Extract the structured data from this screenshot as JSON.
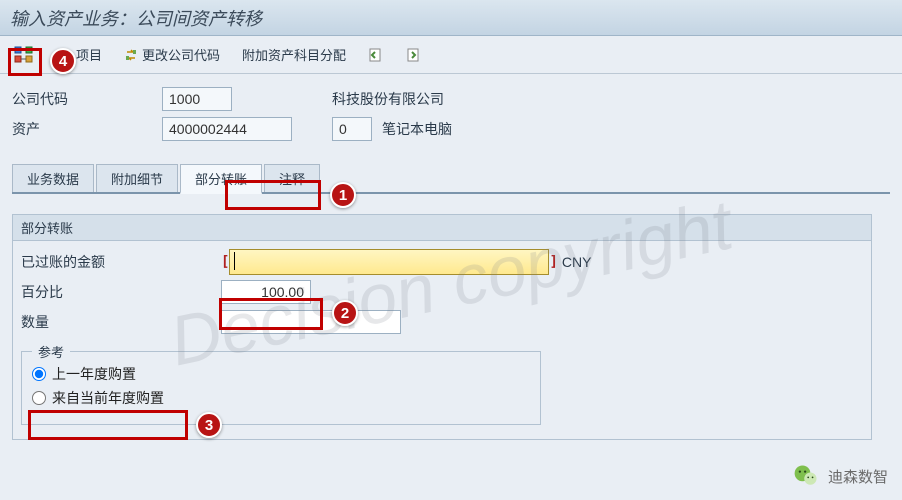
{
  "title": "输入资产业务：公司间资产转移",
  "toolbar": {
    "item_label": "项目",
    "change_company_label": "更改公司代码",
    "extra_account_label": "附加资产科目分配"
  },
  "header": {
    "company_code_label": "公司代码",
    "company_code_value": "1000",
    "company_name": "科技股份有限公司",
    "asset_label": "资产",
    "asset_value": "4000002444",
    "subno_value": "0",
    "asset_desc": "笔记本电脑"
  },
  "tabs": {
    "t1": "业务数据",
    "t2": "附加细节",
    "t3": "部分转账",
    "t4": "注释"
  },
  "partial": {
    "group_title": "部分转账",
    "posted_amount_label": "已过账的金额",
    "currency": "CNY",
    "percent_label": "百分比",
    "percent_value": "100.00",
    "quantity_label": "数量",
    "quantity_value": ""
  },
  "reference": {
    "legend": "参考",
    "prev_year": "上一年度购置",
    "curr_year": "来自当前年度购置"
  },
  "callouts": {
    "n1": "1",
    "n2": "2",
    "n3": "3",
    "n4": "4"
  },
  "watermark": "Decision copyright",
  "brand": "迪森数智"
}
